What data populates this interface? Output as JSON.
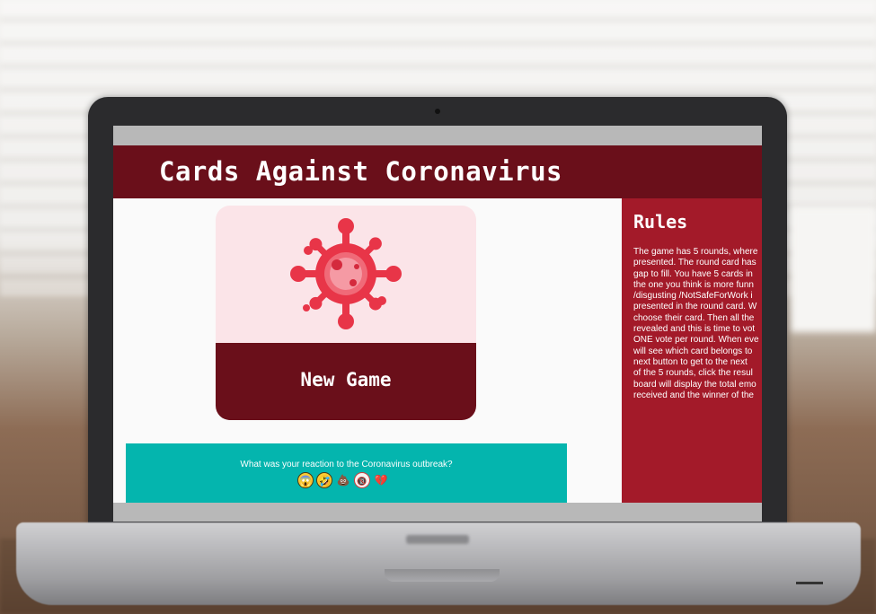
{
  "app": {
    "title": "Cards Against Coronavirus"
  },
  "card": {
    "label": "New Game",
    "icon": "virus-icon",
    "colors": {
      "top": "#fbe4e8",
      "bottom": "#6a0f1a",
      "virus": "#e83548"
    }
  },
  "reaction": {
    "question": "What was your reaction to the Coronavirus outbreak?",
    "emojis": [
      "😱",
      "🤣",
      "💩",
      "🔞",
      "💔"
    ]
  },
  "rules": {
    "title": "Rules",
    "lines": [
      "The game has 5 rounds, where",
      "presented. The round card has",
      "gap to fill. You have 5 cards in",
      "the one you think is more funn",
      "/disgusting /NotSafeForWork i",
      "presented in the round card. W",
      "choose their card. Then all the",
      "revealed and this is time to vot",
      "ONE vote per round. When eve",
      "will see which card belongs to",
      "next button to get to the next",
      "of the 5 rounds, click the resul",
      "board will display the total emo",
      "received and the winner of the"
    ]
  },
  "colors": {
    "header": "#6a0f1a",
    "sidebar": "#a31a29",
    "reaction_bar": "#04b5ae"
  }
}
